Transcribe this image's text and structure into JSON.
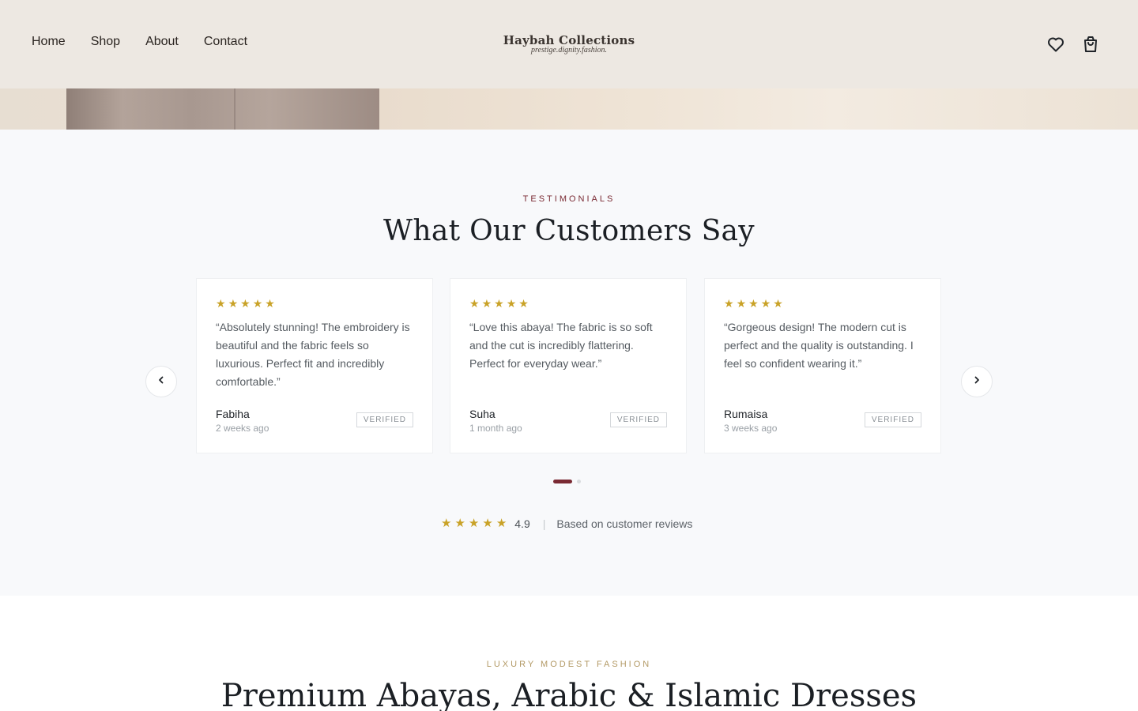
{
  "header": {
    "nav": [
      "Home",
      "Shop",
      "About",
      "Contact"
    ],
    "logo_title": "Haybah Collections",
    "logo_tagline": "prestige.dignity.fashion.",
    "icons": [
      "heart-icon",
      "shopping-bag-icon"
    ]
  },
  "testimonials": {
    "eyebrow": "TESTIMONIALS",
    "title": "What Our Customers Say",
    "cards": [
      {
        "rating": 5,
        "quote": "“Absolutely stunning! The embroidery is beautiful and the fabric feels so luxurious. Perfect fit and incredibly comfortable.”",
        "name": "Fabiha",
        "time": "2 weeks ago",
        "badge": "VERIFIED"
      },
      {
        "rating": 5,
        "quote": "“Love this abaya! The fabric is so soft and the cut is incredibly flattering. Perfect for everyday wear.”",
        "name": "Suha",
        "time": "1 month ago",
        "badge": "VERIFIED"
      },
      {
        "rating": 5,
        "quote": "“Gorgeous design! The modern cut is perfect and the quality is outstanding. I feel so confident wearing it.”",
        "name": "Rumaisa",
        "time": "3 weeks ago",
        "badge": "VERIFIED"
      }
    ],
    "carousel": {
      "pages": 2,
      "active_page": 1
    },
    "summary": {
      "stars": 5,
      "score": "4.9",
      "separator": "|",
      "text": "Based on customer reviews"
    }
  },
  "collection": {
    "eyebrow": "LUXURY MODEST FASHION",
    "title": "Premium Abayas, Arabic & Islamic Dresses"
  },
  "colors": {
    "accent": "#7a2a33",
    "star": "#c9a227",
    "gold_eyebrow": "#b39a66"
  }
}
